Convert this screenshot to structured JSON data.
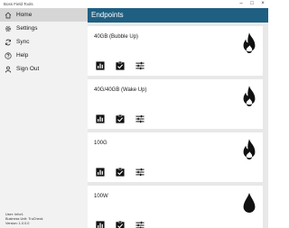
{
  "app": {
    "title": "Boss Field Tools"
  },
  "sidebar": {
    "items": [
      {
        "label": "Home",
        "icon": "home-icon",
        "active": true
      },
      {
        "label": "Settings",
        "icon": "gear-icon",
        "active": false
      },
      {
        "label": "Sync",
        "icon": "sync-icon",
        "active": false
      },
      {
        "label": "Help",
        "icon": "help-icon",
        "active": false
      },
      {
        "label": "Sign Out",
        "icon": "person-icon",
        "active": false
      }
    ],
    "user_lines": [
      "User: Infor1",
      "Business Unit: TruCheck",
      "Version: 1.0.0.0"
    ]
  },
  "main": {
    "header": "Endpoints",
    "endpoints": [
      {
        "name": "40GB (Bubble Up)",
        "icon": "flame-icon"
      },
      {
        "name": "40G/40GB (Wake Up)",
        "icon": "flame-icon"
      },
      {
        "name": "100G",
        "icon": "flame-icon"
      },
      {
        "name": "100W",
        "icon": "water-drop-icon"
      }
    ]
  },
  "colors": {
    "header_bg": "#1f5f82",
    "sidebar_bg": "#f2f2f2",
    "list_bg": "#e8e8e8",
    "active_item": "#d6d6d6"
  }
}
